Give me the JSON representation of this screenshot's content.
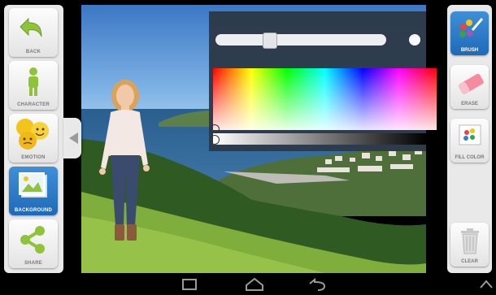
{
  "left_tools": [
    {
      "label": "BACK",
      "icon": "back-arrow-icon"
    },
    {
      "label": "CHARACTER",
      "icon": "character-icon"
    },
    {
      "label": "EMOTION",
      "icon": "emotion-icon"
    },
    {
      "label": "BACKGROUND",
      "icon": "background-icon",
      "active": true
    },
    {
      "label": "SHARE",
      "icon": "share-icon"
    }
  ],
  "right_tools": [
    {
      "label": "BRUSH",
      "icon": "brush-icon",
      "active": true
    },
    {
      "label": "ERASE",
      "icon": "eraser-icon"
    },
    {
      "label": "FILL COLOR",
      "icon": "fill-color-icon"
    },
    {
      "label": "CLEAR",
      "icon": "trash-icon"
    }
  ],
  "color_picker": {
    "brush_size_fraction": 0.3
  },
  "colors": {
    "accent_blue": "#2a78c9",
    "panel_bg": "#2d3a49",
    "sidebar_bg": "#e9e9e9"
  },
  "android_nav": [
    "recents-icon",
    "home-icon",
    "back-icon",
    "menu-up-icon"
  ]
}
